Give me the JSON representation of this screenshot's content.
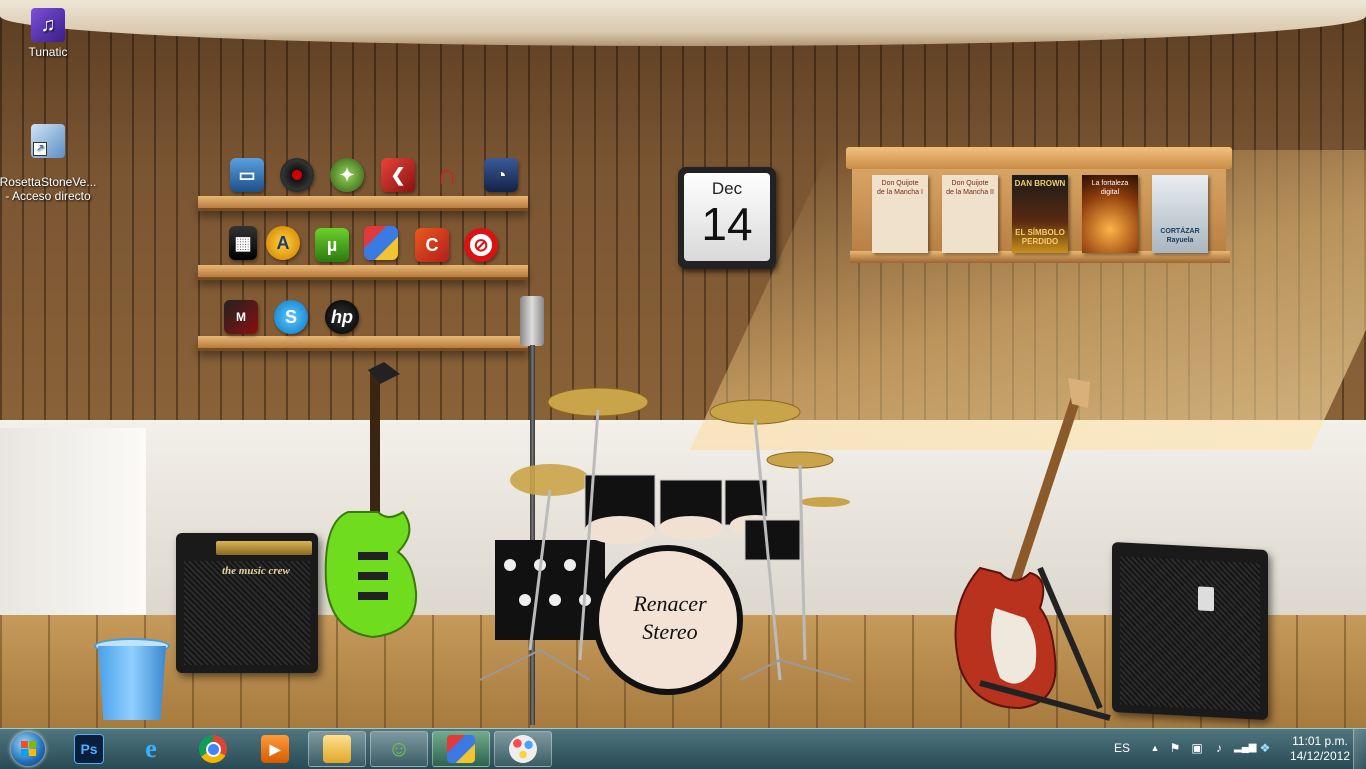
{
  "desktop_icons": [
    {
      "label": "Tunatic"
    },
    {
      "label": "RosettaStoneVe...\n- Acceso directo"
    }
  ],
  "shelf_icons": {
    "row1": [
      "computer-icon",
      "vinyl-record-icon",
      "globe-icon",
      "slideshow-icon",
      "headphones-icon",
      "video-converter-icon"
    ],
    "row2": [
      "blackberry-icon",
      "avast-icon",
      "utorrent-icon",
      "cubes-icon",
      "ccleaner-icon",
      "no-symbol-icon"
    ],
    "row3": [
      "malwarebytes-icon",
      "skype-icon",
      "hp-icon"
    ]
  },
  "calendar": {
    "month": "Dec",
    "day": "14"
  },
  "books": [
    {
      "title": "Don Quijote",
      "subtitle": "de la Mancha I"
    },
    {
      "title": "Don Quijote",
      "subtitle": "de la Mancha II"
    },
    {
      "title": "DAN BROWN",
      "subtitle": "EL SÍMBOLO PERDIDO"
    },
    {
      "title": "La fortaleza",
      "subtitle": "digital"
    },
    {
      "title": "CORTÁZAR",
      "subtitle": "Rayuela"
    }
  ],
  "amp_left": {
    "brand": "the music crew"
  },
  "drum": {
    "line1": "Renacer",
    "line2": "Stereo"
  },
  "taskbar": {
    "items": [
      "photoshop",
      "internet-explorer",
      "chrome",
      "media-player",
      "file-explorer",
      "messenger",
      "cubes-app",
      "paint"
    ],
    "language": "ES",
    "time": "11:01 p.m.",
    "date": "14/12/2012"
  }
}
